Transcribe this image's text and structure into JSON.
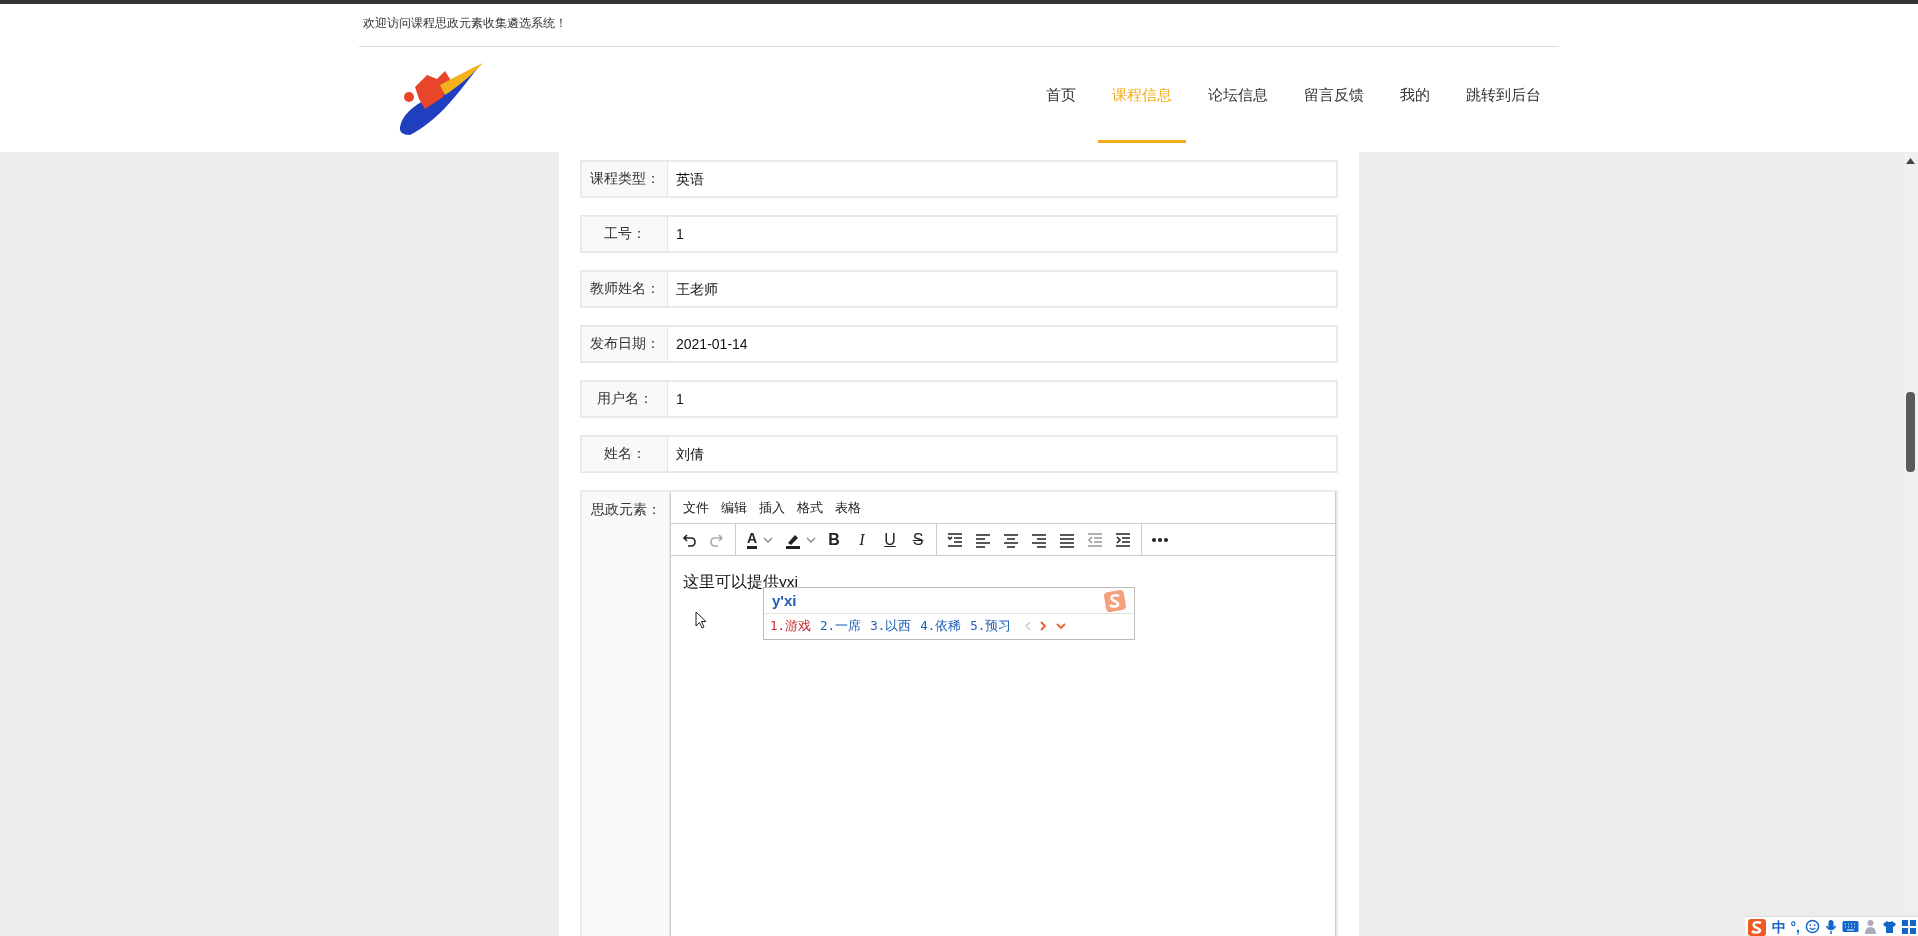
{
  "header": {
    "welcome": "欢迎访问课程思政元素收集遴选系统！",
    "nav": [
      {
        "label": "首页",
        "selected": false
      },
      {
        "label": "课程信息",
        "selected": true
      },
      {
        "label": "论坛信息",
        "selected": false
      },
      {
        "label": "留言反馈",
        "selected": false
      },
      {
        "label": "我的",
        "selected": false
      },
      {
        "label": "跳转到后台",
        "selected": false
      }
    ]
  },
  "form": {
    "fields": [
      {
        "label": "课程类型：",
        "value": "英语"
      },
      {
        "label": "工号：",
        "value": "1"
      },
      {
        "label": "教师姓名：",
        "value": "王老师"
      },
      {
        "label": "发布日期：",
        "value": "2021-01-14"
      },
      {
        "label": "用户名：",
        "value": "1"
      },
      {
        "label": "姓名：",
        "value": "刘倩"
      }
    ],
    "editor": {
      "label": "思政元素：",
      "menu": [
        "文件",
        "编辑",
        "插入",
        "格式",
        "表格"
      ],
      "text_color_glyph": "A",
      "format_glyphs": [
        "B",
        "I",
        "U",
        "S"
      ],
      "content": "这里可以提供yxi"
    }
  },
  "ime": {
    "composition": "y'xi",
    "candidates": [
      {
        "label": "1.游戏",
        "selected": true
      },
      {
        "label": "2.一席",
        "selected": false
      },
      {
        "label": "3.以西",
        "selected": false
      },
      {
        "label": "4.依稀",
        "selected": false
      },
      {
        "label": "5.预习",
        "selected": false
      }
    ]
  },
  "tray": {
    "mode": "中",
    "punctuation": "°,"
  }
}
